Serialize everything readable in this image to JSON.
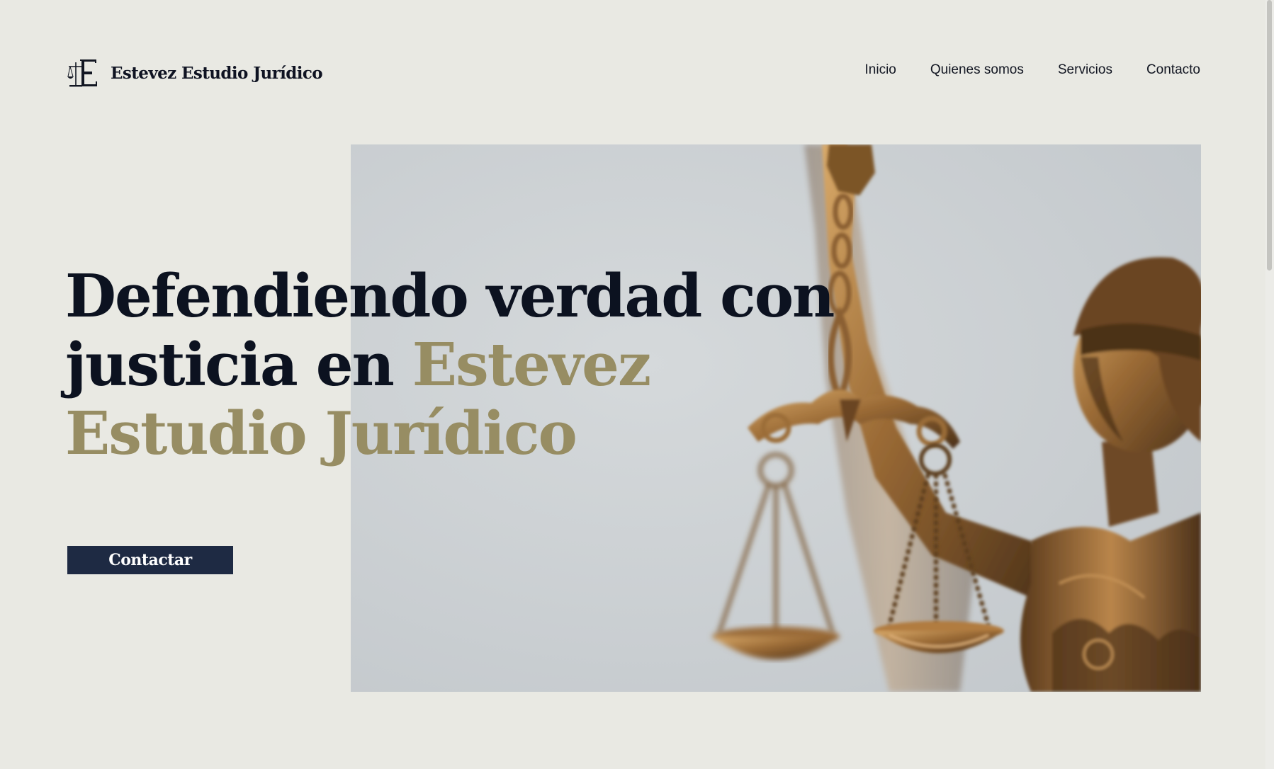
{
  "brand": {
    "name": "Estevez Estudio Jurídico",
    "logo_icon": "scales-of-justice-e-monogram-icon"
  },
  "nav": {
    "items": [
      {
        "label": "Inicio"
      },
      {
        "label": "Quienes somos"
      },
      {
        "label": "Servicios"
      },
      {
        "label": "Contacto"
      }
    ]
  },
  "hero": {
    "headline_part1": "Defendiendo verdad con justicia en ",
    "headline_accent": "Estevez Estudio Jurídico",
    "cta_label": "Contactar",
    "image_subject": "lady-justice-statue-image"
  },
  "colors": {
    "background": "#e9e9e3",
    "text_dark": "#0c1220",
    "accent_gold": "#978d63",
    "button_navy": "#1e2a43",
    "button_text": "#ffffff"
  }
}
